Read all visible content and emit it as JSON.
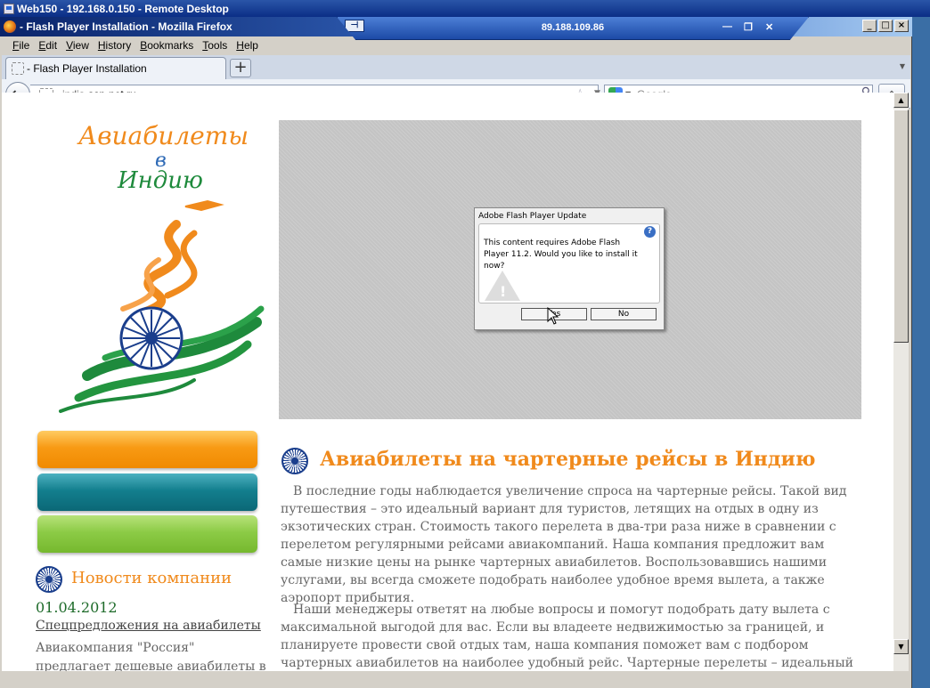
{
  "remote_desktop": {
    "title": "Web150 - 192.168.0.150 - Remote Desktop",
    "bar_address": "89.188.109.86"
  },
  "browser": {
    "window_title": "- Flash Player Installation - Mozilla Firefox",
    "menu": [
      "File",
      "Edit",
      "View",
      "History",
      "Bookmarks",
      "Tools",
      "Help"
    ],
    "tab_title": "- Flash Player Installation",
    "new_tab_symbol": "+",
    "url_prefix": "india.",
    "url_domain": "asp-net.ru",
    "search_placeholder": "Google"
  },
  "page": {
    "logo_line1": "Авиабилеты",
    "logo_line2": "в",
    "logo_line3": "Индию",
    "news": {
      "heading": "Новости компании",
      "date": "01.04.2012",
      "link": "Спецпредложения на авиабилеты",
      "text": "Авиакомпания \"Россия\" предлагает дешевые авиабилеты в Англию,"
    },
    "article": {
      "title": "Авиабилеты на чартерные рейсы в Индию",
      "paragraph1": "В последние годы наблюдается увеличение спроса на чартерные рейсы. Такой вид путешествия – это идеальный вариант для туристов, летящих на отдых в одну из экзотических стран. Стоимость такого перелета в два-три раза ниже в сравнении с перелетом регулярными рейсами авиакомпаний. Наша компания предложит вам самые низкие цены на рынке чартерных авиабилетов. Воспользовавшись нашими услугами, вы всегда сможете подобрать наиболее удобное время вылета, а также аэропорт прибытия.",
      "paragraph2": "Наши менеджеры ответят на любые вопросы и помогут подобрать дату вылета с максимальной выгодой для вас. Если вы владеете недвижимостью за границей, и планируете провести свой отдых там, наша компания поможет вам с подбором чартерных авиабилетов на наиболее удобный рейс. Чартерные перелеты – идеальный вариант для поклонников дикого"
    }
  },
  "flash_dialog": {
    "title": "Adobe Flash Player Update",
    "message": "This content requires Adobe Flash Player 11.2. Would you like to install it now?",
    "yes_label": "Yes",
    "no_label": "No"
  },
  "colors": {
    "orange": "#f08a1c",
    "teal": "#137f8e",
    "green": "#8ccb46",
    "india_blue": "#1a3e8c"
  }
}
